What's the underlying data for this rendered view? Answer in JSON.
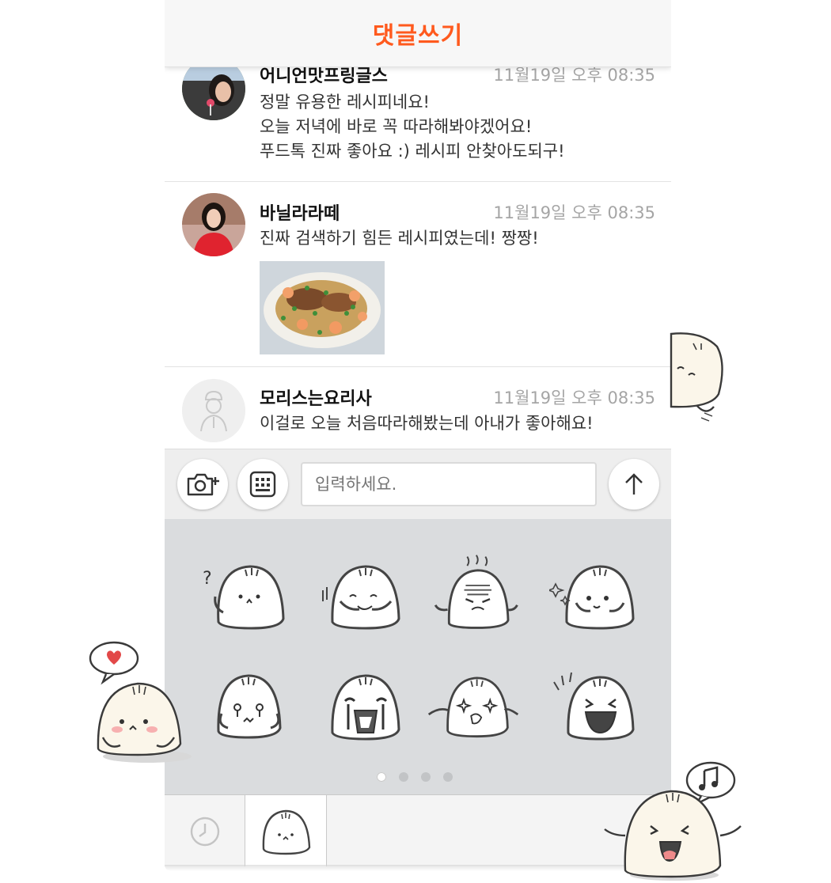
{
  "header": {
    "title": "댓글쓰기"
  },
  "comments": [
    {
      "name": "어니언맛프링글스",
      "time": "11월19일 오후 08:35",
      "lines": [
        "정말 유용한 레시피네요!",
        "오늘 저녁에 바로 꼭 따라해봐야겠어요!",
        "푸드톡 진짜 좋아요 :) 레시피 안찾아도되구!"
      ]
    },
    {
      "name": "바닐라라떼",
      "time": "11월19일 오후 08:35",
      "lines": [
        "진짜 검색하기 힘든 레시피였는데! 짱짱!"
      ]
    },
    {
      "name": "모리스는요리사",
      "time": "11월19일 오후 08:35",
      "lines": [
        "이걸로 오늘 처음따라해봤는데 아내가 좋아해요!"
      ]
    }
  ],
  "input": {
    "placeholder": "입력하세요."
  },
  "icons": {
    "camera": "camera-plus-icon",
    "keyboard": "keyboard-icon",
    "send": "arrow-up-icon",
    "recent": "clock-icon"
  },
  "pager": {
    "total": 4,
    "current": 1
  },
  "colors": {
    "accent": "#ff5a1e",
    "panel": "#dadcde"
  }
}
